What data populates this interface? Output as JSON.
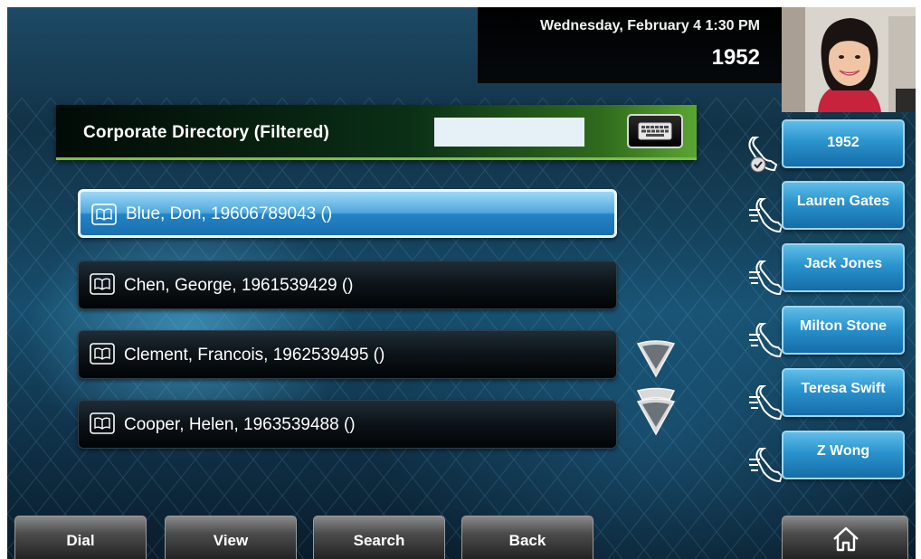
{
  "status": {
    "datetime": "Wednesday, February 4  1:30 PM",
    "line_number": "1952"
  },
  "directory": {
    "title": "Corporate Directory (Filtered)",
    "search_value": "",
    "entries": [
      {
        "text": "Blue, Don,  19606789043 ()",
        "selected": true,
        "icon": "book-icon"
      },
      {
        "text": "Chen, George,  1961539429 ()",
        "selected": false,
        "icon": "book-icon"
      },
      {
        "text": "Clement, Francois,  1962539495 ()",
        "selected": false,
        "icon": "book-icon"
      },
      {
        "text": "Cooper, Helen,  1963539488 ()",
        "selected": false,
        "icon": "book-icon"
      }
    ]
  },
  "line_keys": [
    {
      "label": "1952",
      "icon": "handset-registered-icon"
    },
    {
      "label": "Lauren Gates",
      "icon": "handset-icon"
    },
    {
      "label": "Jack Jones",
      "icon": "handset-icon"
    },
    {
      "label": "Milton Stone",
      "icon": "handset-icon"
    },
    {
      "label": "Teresa Swift",
      "icon": "handset-icon"
    },
    {
      "label": "Z Wong",
      "icon": "handset-icon"
    }
  ],
  "softkeys": {
    "dial": "Dial",
    "view": "View",
    "search": "Search",
    "back": "Back",
    "home_icon": "home-icon"
  },
  "colors": {
    "selected_entry": "#2283c6",
    "title_bar_accent": "#7cc23a",
    "line_key": "#2a93cd"
  }
}
